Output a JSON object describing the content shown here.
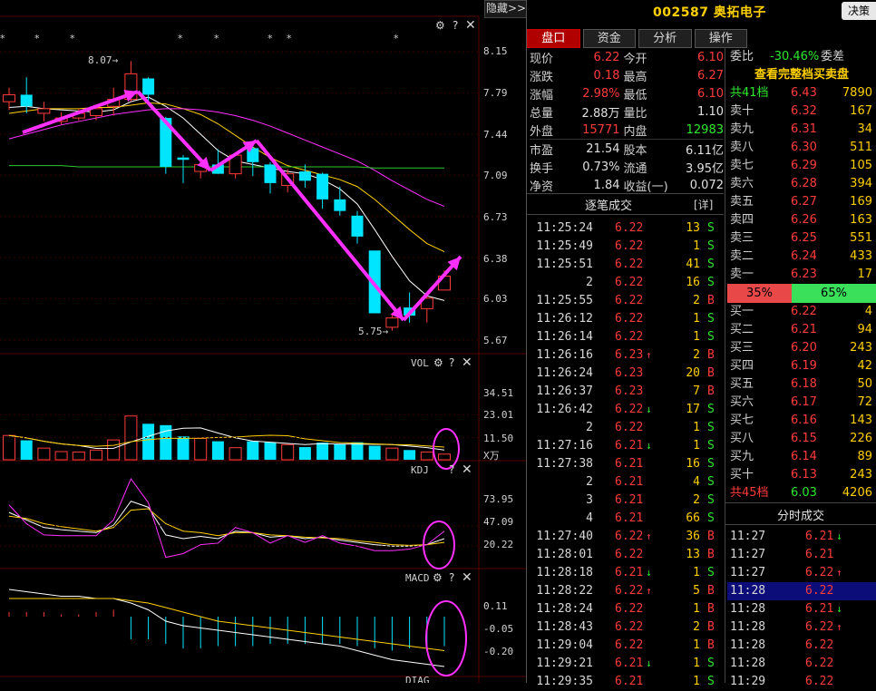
{
  "left_panel": {
    "hide_button": "隐藏>>",
    "main_stars": [
      "*",
      "*",
      "*",
      "*",
      "*",
      "*",
      "*",
      "*",
      "*"
    ],
    "price_high_label": "8.07",
    "price_low_label": "5.75",
    "price_axis": [
      "8.15",
      "7.79",
      "7.44",
      "7.09",
      "6.73",
      "6.38",
      "6.03",
      "5.67"
    ],
    "vol_title": "VOL",
    "vol_axis": [
      "34.51",
      "23.01",
      "11.50",
      "X万"
    ],
    "kdj_title": "KDJ",
    "kdj_axis": [
      "73.95",
      "47.09",
      "20.22"
    ],
    "macd_title": "MACD",
    "macd_axis": [
      "0.11",
      "-0.05",
      "-0.20"
    ],
    "bottom_label": "DIAG"
  },
  "chart_data": {
    "type": "candlestick",
    "candles": [
      {
        "o": 7.72,
        "h": 7.84,
        "l": 7.65,
        "c": 7.78
      },
      {
        "o": 7.78,
        "h": 7.93,
        "l": 7.62,
        "c": 7.68
      },
      {
        "o": 7.62,
        "h": 7.72,
        "l": 7.55,
        "c": 7.66
      },
      {
        "o": 7.55,
        "h": 7.63,
        "l": 7.52,
        "c": 7.58
      },
      {
        "o": 7.58,
        "h": 7.66,
        "l": 7.56,
        "c": 7.62
      },
      {
        "o": 7.6,
        "h": 7.69,
        "l": 7.56,
        "c": 7.66
      },
      {
        "o": 7.68,
        "h": 7.84,
        "l": 7.6,
        "c": 7.74
      },
      {
        "o": 7.74,
        "h": 8.07,
        "l": 7.72,
        "c": 7.96
      },
      {
        "o": 7.92,
        "h": 7.93,
        "l": 7.7,
        "c": 7.78
      },
      {
        "o": 7.58,
        "h": 7.59,
        "l": 7.1,
        "c": 7.16
      },
      {
        "o": 7.24,
        "h": 7.26,
        "l": 7.02,
        "c": 7.22
      },
      {
        "o": 7.12,
        "h": 7.22,
        "l": 7.06,
        "c": 7.18
      },
      {
        "o": 7.18,
        "h": 7.31,
        "l": 7.1,
        "c": 7.1
      },
      {
        "o": 7.1,
        "h": 7.28,
        "l": 7.06,
        "c": 7.26
      },
      {
        "o": 7.32,
        "h": 7.34,
        "l": 7.08,
        "c": 7.2
      },
      {
        "o": 7.18,
        "h": 7.2,
        "l": 6.93,
        "c": 7.02
      },
      {
        "o": 7.0,
        "h": 7.14,
        "l": 6.94,
        "c": 7.1
      },
      {
        "o": 7.12,
        "h": 7.18,
        "l": 6.98,
        "c": 7.04
      },
      {
        "o": 7.1,
        "h": 7.11,
        "l": 6.8,
        "c": 6.88
      },
      {
        "o": 6.88,
        "h": 6.99,
        "l": 6.74,
        "c": 6.78
      },
      {
        "o": 6.74,
        "h": 6.78,
        "l": 6.5,
        "c": 6.56
      },
      {
        "o": 6.44,
        "h": 6.44,
        "l": 5.9,
        "c": 5.9
      },
      {
        "o": 5.78,
        "h": 5.89,
        "l": 5.75,
        "c": 5.86
      },
      {
        "o": 5.95,
        "h": 6.08,
        "l": 5.82,
        "c": 5.88
      },
      {
        "o": 5.94,
        "h": 6.08,
        "l": 5.82,
        "c": 6.03
      },
      {
        "o": 6.1,
        "h": 6.27,
        "l": 6.1,
        "c": 6.22
      }
    ],
    "volume": [
      12.5,
      10.0,
      6.0,
      4.2,
      4.0,
      5.0,
      10.2,
      22.5,
      18.5,
      17.8,
      12.0,
      11.0,
      9.5,
      6.2,
      9.5,
      9.0,
      7.8,
      6.5,
      8.8,
      8.0,
      9.0,
      7.2,
      6.0,
      5.0,
      4.0,
      2.9
    ],
    "ma_lines": [
      {
        "color": "#ffffff",
        "values": [
          7.67,
          7.68,
          7.66,
          7.65,
          7.64,
          7.63,
          7.65,
          7.72,
          7.76,
          7.68,
          7.58,
          7.44,
          7.3,
          7.21,
          7.18,
          7.15,
          7.12,
          7.1,
          7.05,
          6.97,
          6.84,
          6.62,
          6.39,
          6.18,
          6.05,
          6.01
        ]
      },
      {
        "color": "#ffd000",
        "values": [
          7.62,
          7.64,
          7.66,
          7.66,
          7.66,
          7.67,
          7.67,
          7.69,
          7.71,
          7.7,
          7.66,
          7.61,
          7.53,
          7.43,
          7.33,
          7.24,
          7.17,
          7.13,
          7.09,
          7.05,
          6.99,
          6.88,
          6.75,
          6.62,
          6.5,
          6.43
        ]
      },
      {
        "color": "#ff30ff",
        "values": [
          7.4,
          7.44,
          7.48,
          7.52,
          7.55,
          7.58,
          7.61,
          7.63,
          7.65,
          7.66,
          7.66,
          7.65,
          7.63,
          7.6,
          7.56,
          7.51,
          7.45,
          7.39,
          7.33,
          7.27,
          7.21,
          7.13,
          7.04,
          6.96,
          6.88,
          6.82
        ]
      },
      {
        "color": "#2ec82e",
        "values": [
          7.17,
          7.17,
          7.17,
          7.17,
          7.16,
          7.16,
          7.16,
          7.16,
          7.16,
          7.16,
          7.16,
          7.16,
          7.16,
          7.16,
          7.16,
          7.16,
          7.16,
          7.16,
          7.16,
          7.16,
          7.16,
          7.15,
          7.15,
          7.15,
          7.15,
          7.15
        ]
      }
    ],
    "kdj": {
      "k": [
        65,
        55,
        45,
        42,
        40,
        38,
        48,
        80,
        72,
        35,
        30,
        33,
        30,
        40,
        38,
        32,
        34,
        30,
        32,
        28,
        25,
        22,
        20,
        20,
        22,
        30
      ],
      "d": [
        60,
        57,
        50,
        46,
        43,
        40,
        45,
        68,
        70,
        50,
        40,
        38,
        34,
        38,
        38,
        35,
        34,
        32,
        31,
        30,
        27,
        25,
        22,
        21,
        22,
        25
      ],
      "j": [
        75,
        50,
        35,
        34,
        34,
        34,
        55,
        110,
        78,
        5,
        10,
        22,
        24,
        45,
        38,
        24,
        34,
        25,
        34,
        24,
        20,
        14,
        14,
        16,
        22,
        40
      ]
    },
    "macd": {
      "bars": [
        0.02,
        0.02,
        0.02,
        0.01,
        0.01,
        0.02,
        0.03,
        -0.1,
        -0.1,
        -0.12,
        -0.14,
        -0.14,
        -0.13,
        -0.13,
        -0.13,
        -0.12,
        -0.12,
        -0.12,
        -0.12,
        -0.12,
        -0.13,
        -0.14,
        -0.15,
        -0.14,
        -0.14,
        -0.13
      ],
      "dif": [
        0.12,
        0.11,
        0.1,
        0.09,
        0.09,
        0.08,
        0.08,
        0.06,
        0.03,
        -0.02,
        -0.04,
        -0.05,
        -0.06,
        -0.07,
        -0.08,
        -0.09,
        -0.1,
        -0.11,
        -0.12,
        -0.13,
        -0.15,
        -0.17,
        -0.19,
        -0.2,
        -0.21,
        -0.22
      ],
      "dea": [
        0.08,
        0.08,
        0.08,
        0.08,
        0.08,
        0.08,
        0.08,
        0.07,
        0.06,
        0.04,
        0.02,
        0.0,
        -0.02,
        -0.03,
        -0.04,
        -0.05,
        -0.06,
        -0.07,
        -0.08,
        -0.09,
        -0.1,
        -0.11,
        -0.12,
        -0.13,
        -0.14,
        -0.15
      ]
    }
  },
  "header": {
    "code": "002587",
    "name": "奥拓电子",
    "jue_button": "决策"
  },
  "tabs": [
    "盘口",
    "资金",
    "分析",
    "操作"
  ],
  "quote_rows": [
    {
      "l1": "现价",
      "v1": "6.22",
      "c1": "red",
      "l2": "今开",
      "v2": "6.10",
      "c2": "red"
    },
    {
      "l1": "涨跌",
      "v1": "0.18",
      "c1": "red",
      "l2": "最高",
      "v2": "6.27",
      "c2": "red"
    },
    {
      "l1": "涨幅",
      "v1": "2.98%",
      "c1": "red",
      "l2": "最低",
      "v2": "6.10",
      "c2": "red"
    },
    {
      "l1": "总量",
      "v1": "2.88万",
      "c1": "white",
      "l2": "量比",
      "v2": "1.10",
      "c2": "white"
    },
    {
      "l1": "外盘",
      "v1": "15771",
      "c1": "red",
      "l2": "内盘",
      "v2": "12983",
      "c2": "green"
    },
    {
      "l1": "市盈",
      "v1": "21.54",
      "c1": "white",
      "l2": "股本",
      "v2": "6.11亿",
      "c2": "white"
    },
    {
      "l1": "换手",
      "v1": "0.73%",
      "c1": "white",
      "l2": "流通",
      "v2": "3.95亿",
      "c2": "white"
    },
    {
      "l1": "净资",
      "v1": "1.84",
      "c1": "white",
      "l2": "收益(一)",
      "v2": "0.072",
      "c2": "white"
    }
  ],
  "trades_header": {
    "title": "逐笔成交",
    "detail": "[详]"
  },
  "trades": [
    {
      "t": "11:25:24",
      "p": "6.22",
      "a": "",
      "v": "13",
      "s": "S"
    },
    {
      "t": "11:25:49",
      "p": "6.22",
      "a": "",
      "v": "1",
      "s": "S"
    },
    {
      "t": "11:25:51",
      "p": "6.22",
      "a": "",
      "v": "41",
      "s": "S"
    },
    {
      "t": "2",
      "p": "6.22",
      "a": "",
      "v": "16",
      "s": "S"
    },
    {
      "t": "11:25:55",
      "p": "6.22",
      "a": "",
      "v": "2",
      "s": "B"
    },
    {
      "t": "11:26:12",
      "p": "6.22",
      "a": "",
      "v": "1",
      "s": "S"
    },
    {
      "t": "11:26:14",
      "p": "6.22",
      "a": "",
      "v": "1",
      "s": "S"
    },
    {
      "t": "11:26:16",
      "p": "6.23",
      "a": "up",
      "v": "2",
      "s": "B"
    },
    {
      "t": "11:26:24",
      "p": "6.23",
      "a": "",
      "v": "20",
      "s": "B"
    },
    {
      "t": "11:26:37",
      "p": "6.23",
      "a": "",
      "v": "7",
      "s": "B"
    },
    {
      "t": "11:26:42",
      "p": "6.22",
      "a": "down",
      "v": "17",
      "s": "S"
    },
    {
      "t": "2",
      "p": "6.22",
      "a": "",
      "v": "1",
      "s": "S"
    },
    {
      "t": "11:27:16",
      "p": "6.21",
      "a": "down",
      "v": "1",
      "s": "S"
    },
    {
      "t": "11:27:38",
      "p": "6.21",
      "a": "",
      "v": "16",
      "s": "S"
    },
    {
      "t": "2",
      "p": "6.21",
      "a": "",
      "v": "4",
      "s": "S"
    },
    {
      "t": "3",
      "p": "6.21",
      "a": "",
      "v": "2",
      "s": "S"
    },
    {
      "t": "4",
      "p": "6.21",
      "a": "",
      "v": "66",
      "s": "S"
    },
    {
      "t": "11:27:40",
      "p": "6.22",
      "a": "up",
      "v": "36",
      "s": "B"
    },
    {
      "t": "11:28:01",
      "p": "6.22",
      "a": "",
      "v": "13",
      "s": "B"
    },
    {
      "t": "11:28:18",
      "p": "6.21",
      "a": "down",
      "v": "1",
      "s": "S"
    },
    {
      "t": "11:28:22",
      "p": "6.22",
      "a": "up",
      "v": "5",
      "s": "B"
    },
    {
      "t": "11:28:24",
      "p": "6.22",
      "a": "",
      "v": "1",
      "s": "B"
    },
    {
      "t": "11:28:43",
      "p": "6.22",
      "a": "",
      "v": "2",
      "s": "B"
    },
    {
      "t": "11:29:04",
      "p": "6.22",
      "a": "",
      "v": "1",
      "s": "B"
    },
    {
      "t": "11:29:21",
      "p": "6.21",
      "a": "down",
      "v": "1",
      "s": "S"
    },
    {
      "t": "11:29:35",
      "p": "6.21",
      "a": "",
      "v": "1",
      "s": "S"
    }
  ],
  "order_book": {
    "weibi_label": "委比",
    "weibi_value": "-30.46%",
    "weicha_label": "委差",
    "full_link": "查看完整档买卖盘",
    "total_sell": {
      "n": "共41档",
      "p": "6.43",
      "v": "7890"
    },
    "sells": [
      {
        "n": "卖十",
        "p": "6.32",
        "v": "167"
      },
      {
        "n": "卖九",
        "p": "6.31",
        "v": "34"
      },
      {
        "n": "卖八",
        "p": "6.30",
        "v": "511"
      },
      {
        "n": "卖七",
        "p": "6.29",
        "v": "105"
      },
      {
        "n": "卖六",
        "p": "6.28",
        "v": "394"
      },
      {
        "n": "卖五",
        "p": "6.27",
        "v": "169"
      },
      {
        "n": "卖四",
        "p": "6.26",
        "v": "163"
      },
      {
        "n": "卖三",
        "p": "6.25",
        "v": "551"
      },
      {
        "n": "卖二",
        "p": "6.24",
        "v": "433"
      },
      {
        "n": "卖一",
        "p": "6.23",
        "v": "17"
      }
    ],
    "ratio_left": "35%",
    "ratio_right": "65%",
    "buys": [
      {
        "n": "买一",
        "p": "6.22",
        "v": "4"
      },
      {
        "n": "买二",
        "p": "6.21",
        "v": "94"
      },
      {
        "n": "买三",
        "p": "6.20",
        "v": "243"
      },
      {
        "n": "买四",
        "p": "6.19",
        "v": "42"
      },
      {
        "n": "买五",
        "p": "6.18",
        "v": "50"
      },
      {
        "n": "买六",
        "p": "6.17",
        "v": "72"
      },
      {
        "n": "买七",
        "p": "6.16",
        "v": "143"
      },
      {
        "n": "买八",
        "p": "6.15",
        "v": "226"
      },
      {
        "n": "买九",
        "p": "6.14",
        "v": "89"
      },
      {
        "n": "买十",
        "p": "6.13",
        "v": "243"
      }
    ],
    "total_buy": {
      "n": "共45档",
      "p": "6.03",
      "v": "4206"
    }
  },
  "fenshi": {
    "title": "分时成交",
    "rows": [
      {
        "t": "11:27",
        "p": "6.21",
        "a": "down"
      },
      {
        "t": "11:27",
        "p": "6.21",
        "a": ""
      },
      {
        "t": "11:27",
        "p": "6.22",
        "a": "up"
      },
      {
        "t": "11:28",
        "p": "6.22",
        "a": "",
        "hl": true
      },
      {
        "t": "11:28",
        "p": "6.21",
        "a": "down"
      },
      {
        "t": "11:28",
        "p": "6.22",
        "a": "up"
      },
      {
        "t": "11:28",
        "p": "6.22",
        "a": ""
      },
      {
        "t": "11:28",
        "p": "6.22",
        "a": ""
      },
      {
        "t": "11:29",
        "p": "6.22",
        "a": ""
      }
    ]
  },
  "colors": {
    "up": "#ff3b3b",
    "down": "#00e5ff",
    "accent": "#ff30ff"
  }
}
